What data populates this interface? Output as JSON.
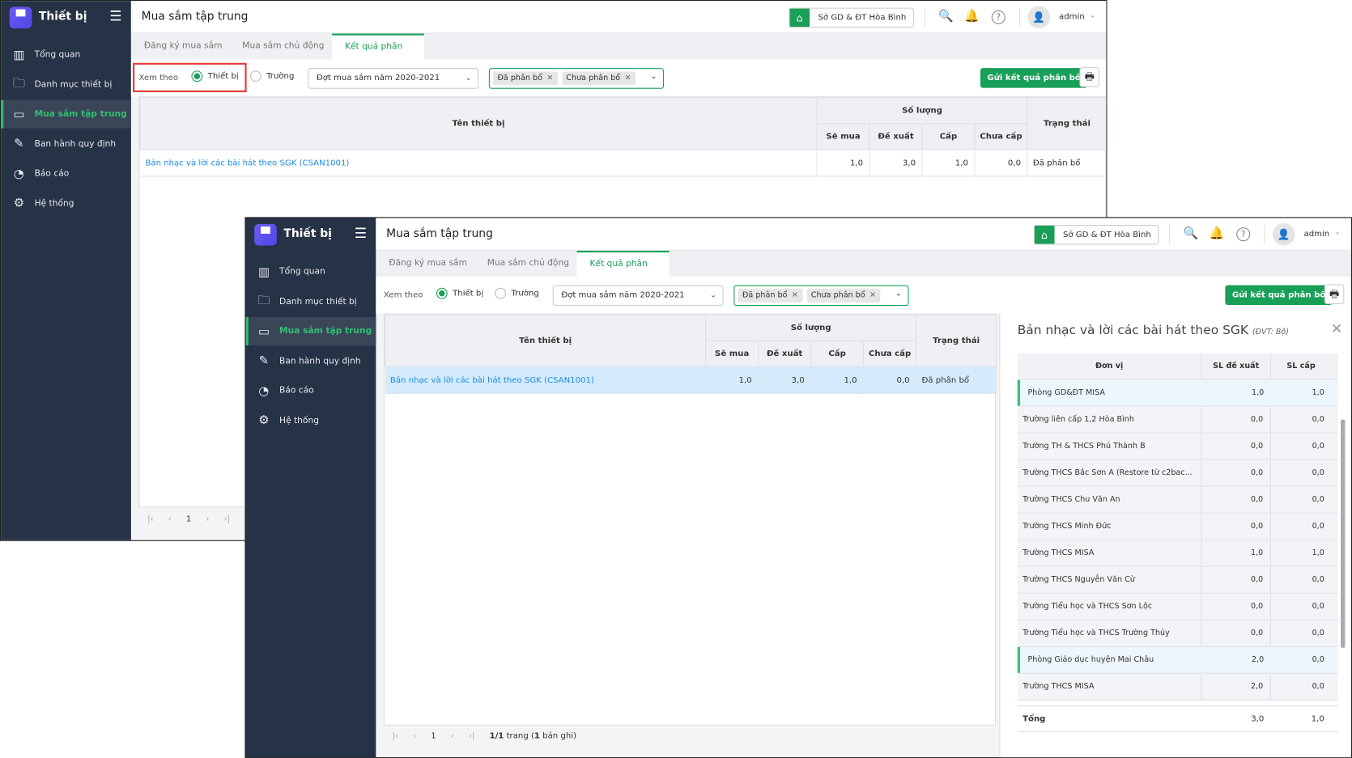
{
  "app": {
    "brand": "Thiết bị",
    "page_title": "Mua sắm tập trung",
    "org": "Sở GD & ĐT Hòa Bình",
    "user": "admin"
  },
  "sidebar": {
    "items": [
      {
        "label": "Tổng quan",
        "icon": "chart-bars-icon"
      },
      {
        "label": "Danh mục thiết bị",
        "icon": "folder-icon"
      },
      {
        "label": "Mua sắm tập trung",
        "icon": "projector-icon",
        "active": true
      },
      {
        "label": "Ban hành quy định",
        "icon": "edit-icon"
      },
      {
        "label": "Báo cáo",
        "icon": "pie-chart-icon"
      },
      {
        "label": "Hệ thống",
        "icon": "gear-icon"
      }
    ]
  },
  "tabs": [
    "Đăng ký mua sắm",
    "Mua sắm chủ động",
    "Kết quả phân bổ"
  ],
  "filters": {
    "view_by": "Xem theo",
    "opt_device": "Thiết bị",
    "opt_school": "Trường",
    "period": "Đợt mua sắm năm 2020-2021",
    "chips": [
      "Đã phân bổ",
      "Chưa phân bổ"
    ],
    "send": "Gửi kết quả phân bổ"
  },
  "grid": {
    "headers": {
      "name": "Tên thiết bị",
      "qty": "Số lượng",
      "status": "Trạng thái",
      "sub": [
        "Sẽ mua",
        "Đề xuất",
        "Cấp",
        "Chưa cấp"
      ]
    },
    "rows": [
      {
        "name": "Bản nhạc và lời các bài hát theo SGK (CSAN1001)",
        "will_buy": "1,0",
        "proposed": "3,0",
        "granted": "1,0",
        "not_granted": "0,0",
        "status": "Đã phân bổ"
      }
    ]
  },
  "pager": {
    "page": "1",
    "info_a": "1/1",
    "info_b": " trang (",
    "info_c": "1",
    "info_d": " bản ghi)"
  },
  "panel": {
    "title": "Bản nhạc và lời các bài hát theo SGK",
    "unit": "(ĐVT: Bộ)",
    "headers": [
      "Đơn vị",
      "SL đề xuất",
      "SL cấp"
    ],
    "rows": [
      {
        "name": "Phòng GD&ĐT MISA",
        "proposed": "1,0",
        "granted": "1,0",
        "group": true
      },
      {
        "name": "Trường liên cấp 1,2 Hòa Bình",
        "proposed": "0,0",
        "granted": "0,0"
      },
      {
        "name": "Trường TH & THCS Phú Thành B",
        "proposed": "0,0",
        "granted": "0,0"
      },
      {
        "name": "Trường THCS Bắc Sơn A (Restore từ c2bac...",
        "proposed": "0,0",
        "granted": "0,0"
      },
      {
        "name": "Trường THCS Chu Văn An",
        "proposed": "0,0",
        "granted": "0,0"
      },
      {
        "name": "Trường THCS Minh Đức",
        "proposed": "0,0",
        "granted": "0,0"
      },
      {
        "name": "Trường THCS MISA",
        "proposed": "1,0",
        "granted": "1,0"
      },
      {
        "name": "Trường THCS Nguyễn Văn Cừ",
        "proposed": "0,0",
        "granted": "0,0"
      },
      {
        "name": "Trường Tiểu học và THCS Sơn Lộc",
        "proposed": "0,0",
        "granted": "0,0"
      },
      {
        "name": "Trường Tiểu học và THCS Trường Thủy",
        "proposed": "0,0",
        "granted": "0,0"
      },
      {
        "name": "Phòng Giáo dục huyện Mai Châu",
        "proposed": "2,0",
        "granted": "0,0",
        "group": true
      },
      {
        "name": "Trường THCS MISA",
        "proposed": "2,0",
        "granted": "0,0"
      }
    ],
    "total_label": "Tổng",
    "total_proposed": "3,0",
    "total_granted": "1,0"
  },
  "colors": {
    "accent": "#18a058",
    "sidebar": "#263245",
    "link": "#1e88e5",
    "highlight": "#e53935"
  }
}
